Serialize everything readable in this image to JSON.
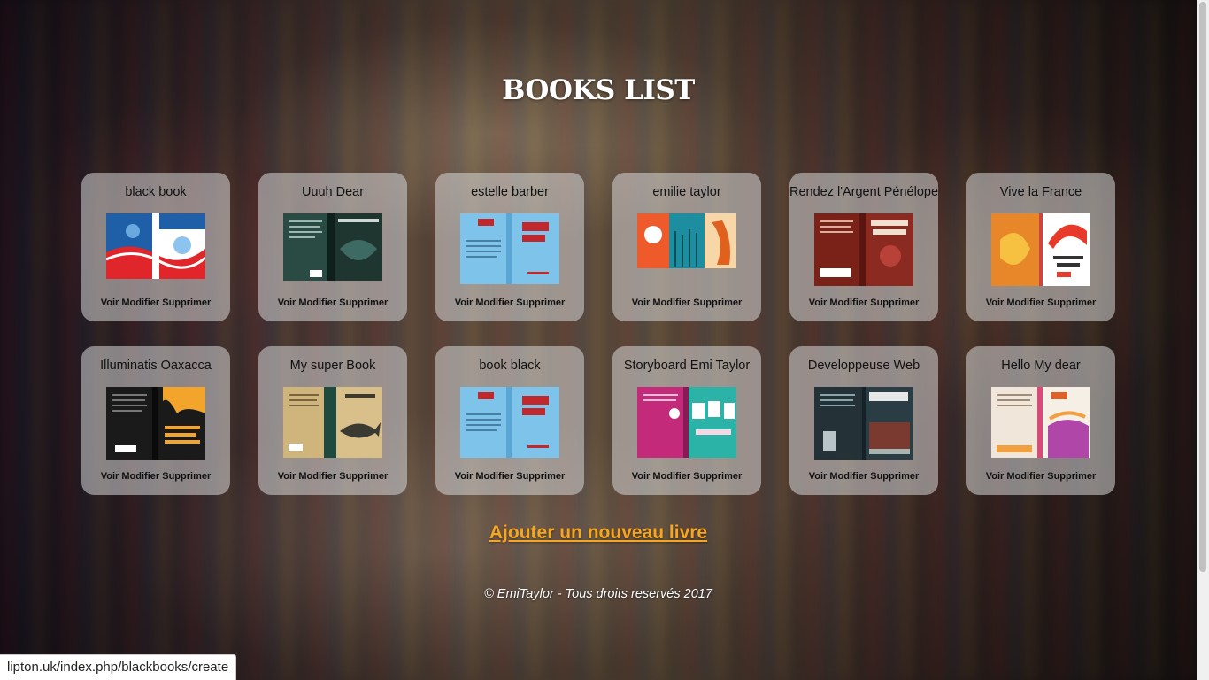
{
  "header": {
    "title": "BOOKS LIST"
  },
  "books": [
    {
      "title": "black book",
      "cover": "blue-red-wave-cover"
    },
    {
      "title": "Uuuh Dear",
      "cover": "enchantress-dark-cover"
    },
    {
      "title": "estelle barber",
      "cover": "light-blue-book-title-cover"
    },
    {
      "title": "emilie taylor",
      "cover": "the-road-orange-teal-cover"
    },
    {
      "title": "Rendez l'Argent Pénélope",
      "cover": "callum-chapman-red-cover"
    },
    {
      "title": "Vive la France",
      "cover": "redesign-the-web-cover"
    },
    {
      "title": "Illuminatis Oaxacca",
      "cover": "power-quality-black-cover"
    },
    {
      "title": "My super Book",
      "cover": "dreaming-of-sweden-fish-cover"
    },
    {
      "title": "book black",
      "cover": "light-blue-book-title-cover"
    },
    {
      "title": "Storyboard Emi Taylor",
      "cover": "marriage-magenta-teal-cover"
    },
    {
      "title": "Developpeuse Web",
      "cover": "project-management-cover"
    },
    {
      "title": "Hello My dear",
      "cover": "rain-dragon-cover"
    }
  ],
  "actions": {
    "view": "Voir",
    "edit": "Modifier",
    "delete": "Supprimer"
  },
  "add_link": "Ajouter un nouveau livre",
  "footer": "© EmiTaylor - Tous droits reservés 2017",
  "status_url": "lipton.uk/index.php/blackbooks/create",
  "colors": {
    "accent": "#f5a623",
    "card_bg": "rgba(215,215,215,0.55)",
    "title": "#ffffff"
  }
}
